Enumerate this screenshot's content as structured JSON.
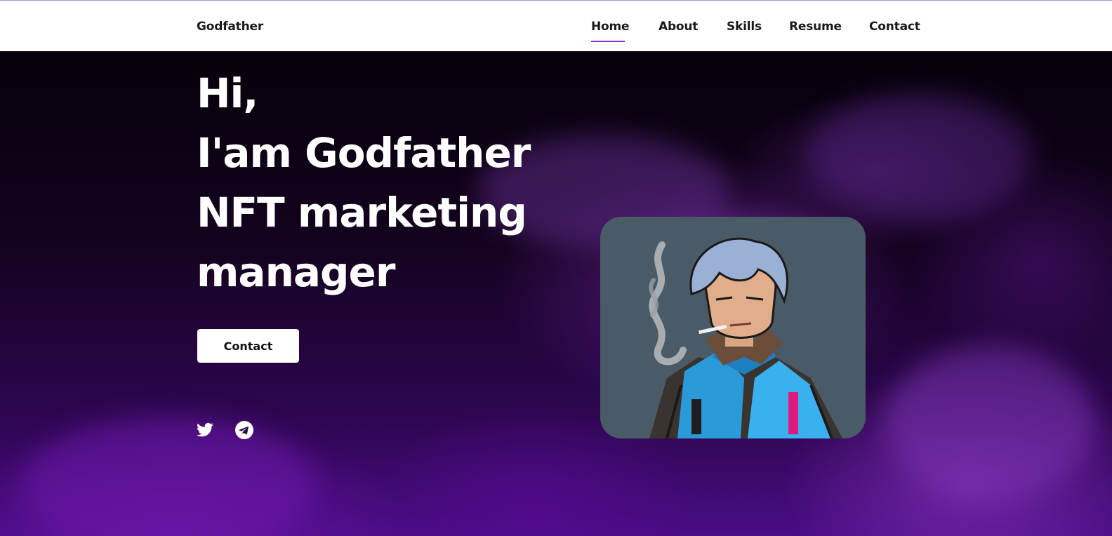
{
  "brand": "Godfather",
  "nav": {
    "items": [
      "Home",
      "About",
      "Skills",
      "Resume",
      "Contact"
    ],
    "active": "Home",
    "accent_color": "#8a2be2"
  },
  "hero": {
    "greeting": "Hi,",
    "name_line": "I'am Godfather",
    "role_line_1": "NFT marketing",
    "role_line_2": "manager",
    "cta_label": "Contact",
    "social": [
      "twitter-icon",
      "telegram-icon"
    ],
    "portrait": "character-illustration"
  }
}
